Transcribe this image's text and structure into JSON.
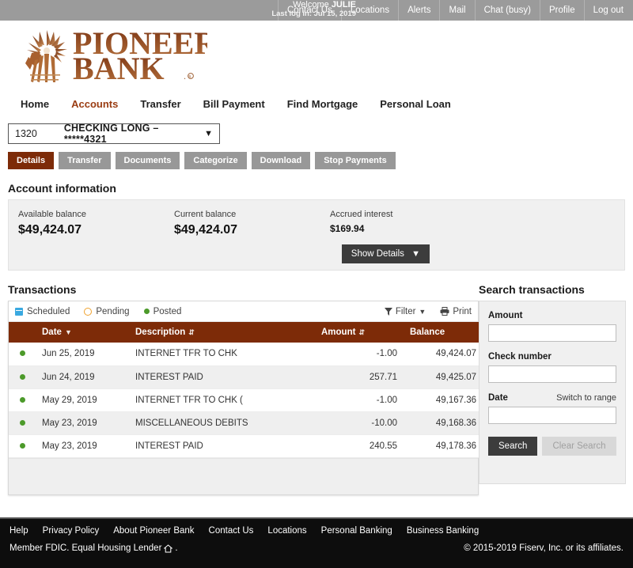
{
  "topbar": {
    "welcome_prefix": "Welcome ",
    "welcome_user": "JULIE",
    "last_login": "Last log in: Jul 15, 2019",
    "links": [
      {
        "label": "Contact Us",
        "name": "topnav-contact-us"
      },
      {
        "label": "Locations",
        "name": "topnav-locations"
      },
      {
        "label": "Alerts",
        "name": "topnav-alerts"
      },
      {
        "label": "Mail",
        "name": "topnav-mail"
      },
      {
        "label": "Chat (busy)",
        "name": "topnav-chat"
      },
      {
        "label": "Profile",
        "name": "topnav-profile"
      },
      {
        "label": "Log out",
        "name": "topnav-logout"
      }
    ]
  },
  "brand": {
    "line1": "PIONEER",
    "line2": "BANK",
    "registered": "®",
    "logo_icon": "windmill-icon"
  },
  "mainnav": {
    "items": [
      {
        "label": "Home",
        "active": false
      },
      {
        "label": "Accounts",
        "active": true
      },
      {
        "label": "Transfer",
        "active": false
      },
      {
        "label": "Bill Payment",
        "active": false
      },
      {
        "label": "Find Mortgage",
        "active": false
      },
      {
        "label": "Personal Loan",
        "active": false
      }
    ]
  },
  "account_selector": {
    "number": "1320",
    "name": "CHECKING LONG – *****4321",
    "caret": "⌄"
  },
  "tabs": [
    {
      "label": "Details",
      "active": true
    },
    {
      "label": "Transfer",
      "active": false
    },
    {
      "label": "Documents",
      "active": false
    },
    {
      "label": "Categorize",
      "active": false
    },
    {
      "label": "Download",
      "active": false
    },
    {
      "label": "Stop Payments",
      "active": false
    }
  ],
  "account_information": {
    "title": "Account information",
    "available_balance_label": "Available balance",
    "available_balance_value": "$49,424.07",
    "current_balance_label": "Current balance",
    "current_balance_value": "$49,424.07",
    "accrued_interest_label": "Accrued interest",
    "accrued_interest_value": "$169.94",
    "show_details_label": "Show Details",
    "show_details_caret": "⌄"
  },
  "transactions": {
    "title": "Transactions",
    "legend": [
      {
        "label": "Scheduled",
        "icon": "calendar-icon",
        "color": "#3aa9e0"
      },
      {
        "label": "Pending",
        "icon": "clock-icon",
        "color": "#f0a22e"
      },
      {
        "label": "Posted",
        "icon": "dot-icon",
        "color": "#4c9a2a"
      }
    ],
    "filter_label": "Filter",
    "filter_caret": "⌄",
    "print_label": "Print",
    "columns": {
      "date": "Date",
      "description": "Description",
      "amount": "Amount",
      "balance": "Balance"
    },
    "rows": [
      {
        "status": "posted",
        "date": "Jun 25, 2019",
        "description": "INTERNET TFR TO CHK",
        "amount": "-1.00",
        "balance": "49,424.07"
      },
      {
        "status": "posted",
        "date": "Jun 24, 2019",
        "description": "INTEREST PAID",
        "amount": "257.71",
        "balance": "49,425.07"
      },
      {
        "status": "posted",
        "date": "May 29, 2019",
        "description": "INTERNET TFR TO CHK (",
        "amount": "-1.00",
        "balance": "49,167.36"
      },
      {
        "status": "posted",
        "date": "May 23, 2019",
        "description": "MISCELLANEOUS DEBITS",
        "amount": "-10.00",
        "balance": "49,168.36"
      },
      {
        "status": "posted",
        "date": "May 23, 2019",
        "description": "INTEREST PAID",
        "amount": "240.55",
        "balance": "49,178.36"
      }
    ]
  },
  "search": {
    "title": "Search transactions",
    "amount_label": "Amount",
    "amount_value": "",
    "check_number_label": "Check number",
    "check_number_value": "",
    "date_label": "Date",
    "date_value": "",
    "switch_to_range_label": "Switch to range",
    "search_button": "Search",
    "clear_button": "Clear Search"
  },
  "footer": {
    "links": [
      "Help",
      "Privacy Policy",
      "About Pioneer Bank",
      "Contact Us",
      "Locations",
      "Personal Banking",
      "Business Banking"
    ],
    "member_text": "Member FDIC. Equal Housing Lender",
    "member_suffix": ".",
    "housing_icon": "equal-housing-icon",
    "copyright": "© 2015-2019 Fiserv, Inc. or its affiliates."
  },
  "colors": {
    "brand_brown": "#7d2b08",
    "accent_brown": "#9a3c12",
    "topbar_gray": "#9b9b9b",
    "dark_button": "#3c3c3c",
    "footer_black": "#0d0d0d"
  }
}
